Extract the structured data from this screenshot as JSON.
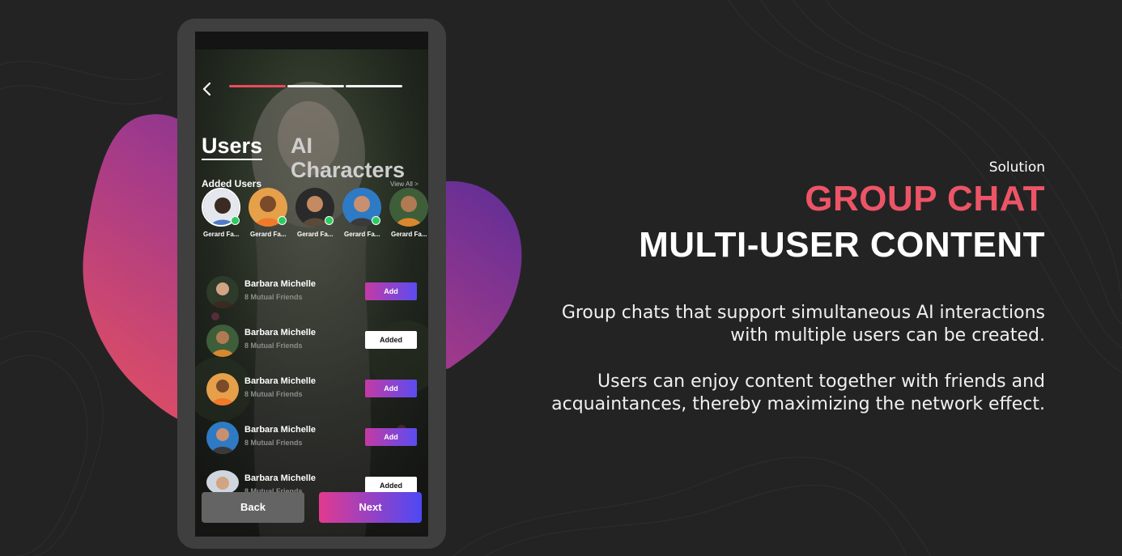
{
  "colors": {
    "background": "#232324",
    "accent": "#ec5566",
    "progress_active": "#ec4a5c",
    "online_dot": "#2ecb5f"
  },
  "phone": {
    "progress_steps": 3,
    "progress_active_step": 1,
    "tabs": [
      {
        "label": "Users",
        "active": true
      },
      {
        "label": "AI Characters",
        "active": false
      }
    ],
    "added_users": {
      "title": "Added Users",
      "view_all": "View All >",
      "users": [
        {
          "name": "Gerard Fa...",
          "online": true
        },
        {
          "name": "Gerard Fa...",
          "online": true
        },
        {
          "name": "Gerard Fa...",
          "online": true
        },
        {
          "name": "Gerard Fa...",
          "online": true
        },
        {
          "name": "Gerard Fa...",
          "online": false
        }
      ]
    },
    "friends": [
      {
        "name": "Barbara Michelle",
        "mutual": "8 Mutual Friends",
        "button": "Add",
        "state": "add"
      },
      {
        "name": "Barbara Michelle",
        "mutual": "8 Mutual Friends",
        "button": "Added",
        "state": "added"
      },
      {
        "name": "Barbara Michelle",
        "mutual": "8 Mutual Friends",
        "button": "Add",
        "state": "add"
      },
      {
        "name": "Barbara Michelle",
        "mutual": "8 Mutual Friends",
        "button": "Add",
        "state": "add"
      },
      {
        "name": "Barbara Michelle",
        "mutual": "8 Mutual Friends",
        "button": "Added",
        "state": "added"
      }
    ],
    "back_label": "Back",
    "next_label": "Next"
  },
  "copy": {
    "kicker": "Solution",
    "title_line1": "GROUP CHAT",
    "title_line2": "MULTI-USER CONTENT",
    "paragraph1_line1": "Group chats that support simultaneous AI interactions",
    "paragraph1_line2": "with multiple users can be created.",
    "paragraph2_line1": "Users can enjoy content together with friends and",
    "paragraph2_line2": "acquaintances, thereby maximizing the network effect."
  }
}
